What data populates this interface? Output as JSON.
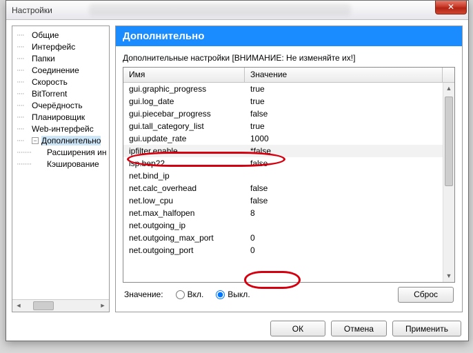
{
  "window": {
    "title": "Настройки",
    "close": "✕"
  },
  "tree": {
    "items": [
      {
        "label": "Общие"
      },
      {
        "label": "Интерфейс"
      },
      {
        "label": "Папки"
      },
      {
        "label": "Соединение"
      },
      {
        "label": "Скорость"
      },
      {
        "label": "BitTorrent"
      },
      {
        "label": "Очерёдность"
      },
      {
        "label": "Планировщик"
      },
      {
        "label": "Web-интерфейс"
      },
      {
        "label": "Дополнительно",
        "expandable": true
      },
      {
        "label": "Расширения ин",
        "child": true
      },
      {
        "label": "Кэширование",
        "child": true
      }
    ]
  },
  "panel": {
    "title": "Дополнительно",
    "warning": "Дополнительные настройки [ВНИМАНИЕ: Не изменяйте их!]",
    "columns": {
      "name": "Имя",
      "value": "Значение"
    },
    "rows": [
      {
        "name": "gui.graphic_progress",
        "value": "true"
      },
      {
        "name": "gui.log_date",
        "value": "true"
      },
      {
        "name": "gui.piecebar_progress",
        "value": "false"
      },
      {
        "name": "gui.tall_category_list",
        "value": "true"
      },
      {
        "name": "gui.update_rate",
        "value": "1000"
      },
      {
        "name": "ipfilter.enable",
        "value": "*false",
        "selected": true
      },
      {
        "name": "isp.bep22",
        "value": "false"
      },
      {
        "name": "net.bind_ip",
        "value": ""
      },
      {
        "name": "net.calc_overhead",
        "value": "false"
      },
      {
        "name": "net.low_cpu",
        "value": "false"
      },
      {
        "name": "net.max_halfopen",
        "value": "8"
      },
      {
        "name": "net.outgoing_ip",
        "value": ""
      },
      {
        "name": "net.outgoing_max_port",
        "value": "0"
      },
      {
        "name": "net.outgoing_port",
        "value": "0"
      }
    ],
    "valueLabel": "Значение:",
    "radioOn": "Вкл.",
    "radioOff": "Выкл.",
    "reset": "Сброс"
  },
  "footer": {
    "ok": "ОК",
    "cancel": "Отмена",
    "apply": "Применить"
  }
}
